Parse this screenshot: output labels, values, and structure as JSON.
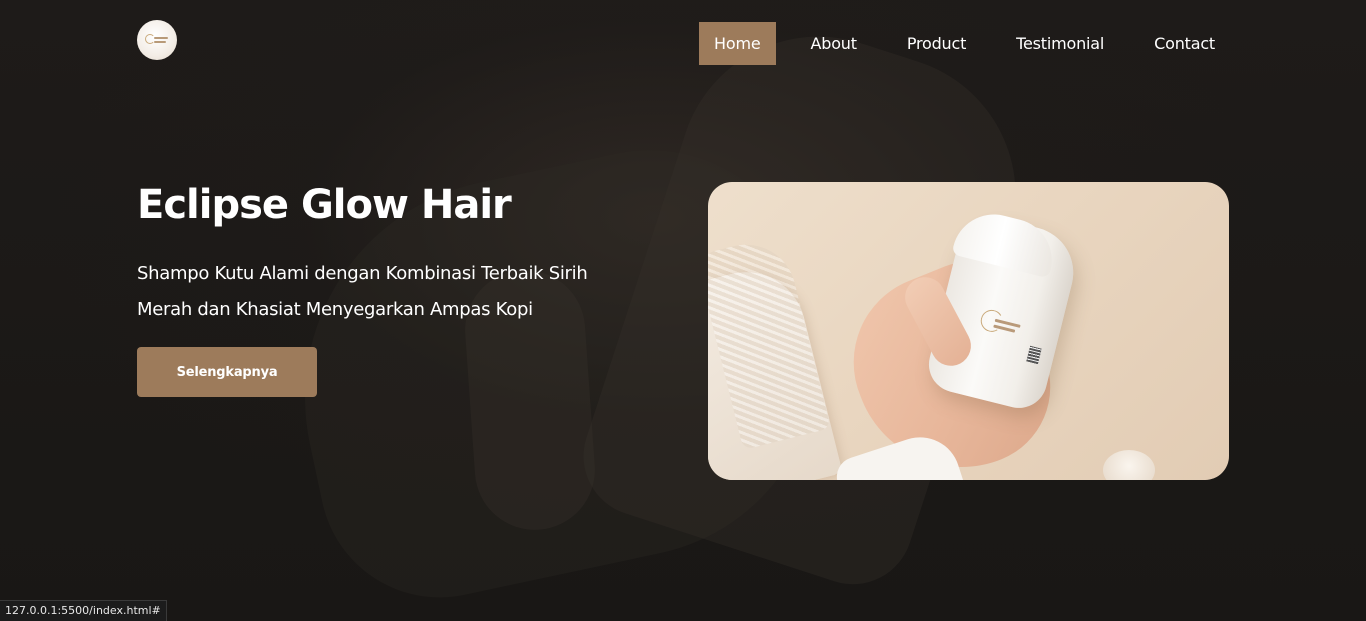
{
  "navbar": {
    "logo_icon": "eclipse-glow-hair-logo",
    "links": [
      {
        "label": "Home",
        "active": true
      },
      {
        "label": "About",
        "active": false
      },
      {
        "label": "Product",
        "active": false
      },
      {
        "label": "Testimonial",
        "active": false
      },
      {
        "label": "Contact",
        "active": false
      }
    ]
  },
  "hero": {
    "title": "Eclipse Glow Hair",
    "description": "Shampo Kutu Alami dengan Kombinasi Terbaik Sirih Merah dan Khasiat Menyegarkan Ampas Kopi",
    "cta_label": "Selengkapnya"
  },
  "status_bar": {
    "url": "127.0.0.1:5500/index.html#"
  },
  "colors": {
    "accent": "#9d7b5b",
    "background": "#1b1816",
    "text": "#ffffff"
  }
}
